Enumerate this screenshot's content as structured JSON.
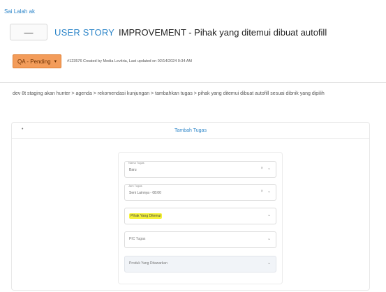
{
  "breadcrumb": "Sai Lalah ak",
  "title": {
    "back_label": "—",
    "type_label": "USER STORY",
    "text": "IMPROVEMENT - Pihak yang ditemui dibuat autofill"
  },
  "status": {
    "label": "QA - Pending",
    "caret": "▾",
    "meta": "#123576 Created by Media Levitria, Last updated on 02/14/2024 9:34 AM"
  },
  "description": "dev 8t staging akan hunter > agenda > rekomendasi kunjungan > tambahkan tugas > pihak yang ditemui dibuat autofill sesuai dibnik yang dipilih",
  "card": {
    "toggle": "•",
    "title": "Tambah Tugas"
  },
  "form": {
    "fields": [
      {
        "label": "Nama Tugas",
        "value": "Baru",
        "clear": "×",
        "chevron": "⌄"
      },
      {
        "label": "Jam Tugas",
        "value": "Seni Lainnya - 08:00",
        "clear": "×",
        "chevron": "⌄"
      },
      {
        "placeholder": "Pihak Yang Ditemui",
        "chevron": "⌄"
      },
      {
        "placeholder": "PIC Tugas",
        "chevron": "⌄"
      },
      {
        "placeholder": "Produk Yang Ditawarkan",
        "chevron": "⌄"
      }
    ]
  },
  "colors": {
    "accent": "#2e86c9",
    "status_badge": "#f39c5a",
    "highlight": "#f5f23a"
  }
}
